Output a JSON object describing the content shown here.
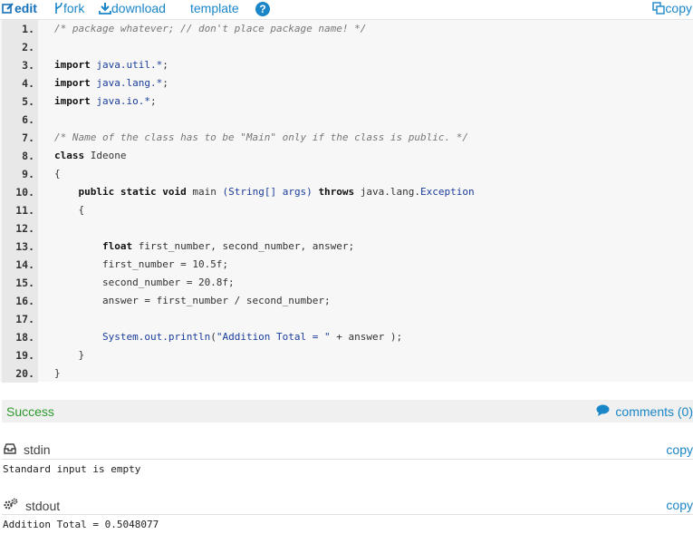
{
  "toolbar": {
    "edit": "edit",
    "fork": "fork",
    "download": "download",
    "template": "template",
    "help": "?",
    "copy": "copy"
  },
  "code_lines": [
    {
      "n": "1.",
      "parts": [
        {
          "c": "tk-com",
          "t": "/* package whatever; // don't place package name! */"
        }
      ]
    },
    {
      "n": "2.",
      "parts": []
    },
    {
      "n": "3.",
      "parts": [
        {
          "c": "tk-kw",
          "t": "import"
        },
        {
          "c": "",
          "t": " "
        },
        {
          "c": "tk-pkg",
          "t": "java.util.*"
        },
        {
          "c": "",
          "t": ";"
        }
      ]
    },
    {
      "n": "4.",
      "parts": [
        {
          "c": "tk-kw",
          "t": "import"
        },
        {
          "c": "",
          "t": " "
        },
        {
          "c": "tk-pkg",
          "t": "java.lang.*"
        },
        {
          "c": "",
          "t": ";"
        }
      ]
    },
    {
      "n": "5.",
      "parts": [
        {
          "c": "tk-kw",
          "t": "import"
        },
        {
          "c": "",
          "t": " "
        },
        {
          "c": "tk-pkg",
          "t": "java.io.*"
        },
        {
          "c": "",
          "t": ";"
        }
      ]
    },
    {
      "n": "6.",
      "parts": []
    },
    {
      "n": "7.",
      "parts": [
        {
          "c": "tk-com",
          "t": "/* Name of the class has to be \"Main\" only if the class is public. */"
        }
      ]
    },
    {
      "n": "8.",
      "parts": [
        {
          "c": "tk-kw",
          "t": "class"
        },
        {
          "c": "",
          "t": " Ideone"
        }
      ]
    },
    {
      "n": "9.",
      "parts": [
        {
          "c": "",
          "t": "{"
        }
      ]
    },
    {
      "n": "10.",
      "parts": [
        {
          "c": "",
          "t": "    "
        },
        {
          "c": "tk-kw",
          "t": "public static void"
        },
        {
          "c": "",
          "t": " main "
        },
        {
          "c": "tk-pkg",
          "t": "(String[] args)"
        },
        {
          "c": "",
          "t": " "
        },
        {
          "c": "tk-kw",
          "t": "throws"
        },
        {
          "c": "",
          "t": " java.lang."
        },
        {
          "c": "tk-pkg",
          "t": "Exception"
        }
      ]
    },
    {
      "n": "11.",
      "parts": [
        {
          "c": "",
          "t": "    {"
        }
      ]
    },
    {
      "n": "12.",
      "parts": []
    },
    {
      "n": "13.",
      "parts": [
        {
          "c": "",
          "t": "        "
        },
        {
          "c": "tk-kw",
          "t": "float"
        },
        {
          "c": "",
          "t": " first_number, second_number, answer;"
        }
      ]
    },
    {
      "n": "14.",
      "parts": [
        {
          "c": "",
          "t": "        first_number = 10.5f;"
        }
      ]
    },
    {
      "n": "15.",
      "parts": [
        {
          "c": "",
          "t": "        second_number = 20.8f;"
        }
      ]
    },
    {
      "n": "16.",
      "parts": [
        {
          "c": "",
          "t": "        answer = first_number / second_number;"
        }
      ]
    },
    {
      "n": "17.",
      "parts": []
    },
    {
      "n": "18.",
      "parts": [
        {
          "c": "",
          "t": "        "
        },
        {
          "c": "tk-pkg",
          "t": "System.out.println"
        },
        {
          "c": "",
          "t": "("
        },
        {
          "c": "tk-str",
          "t": "\"Addition Total = \""
        },
        {
          "c": "",
          "t": " + answer );"
        }
      ]
    },
    {
      "n": "19.",
      "parts": [
        {
          "c": "",
          "t": "    }"
        }
      ]
    },
    {
      "n": "20.",
      "parts": [
        {
          "c": "",
          "t": "}"
        }
      ]
    }
  ],
  "status": {
    "result": "Success",
    "comments": "comments (0)"
  },
  "stdin": {
    "title": "stdin",
    "copy": "copy",
    "content": "Standard input is empty"
  },
  "stdout": {
    "title": "stdout",
    "copy": "copy",
    "content": "Addition Total = 0.5048077"
  },
  "colors": {
    "link": "#1a86c8",
    "success": "#2e9a2e",
    "gutter": "#e8e8e8",
    "code_bg": "#f7f7f7"
  }
}
